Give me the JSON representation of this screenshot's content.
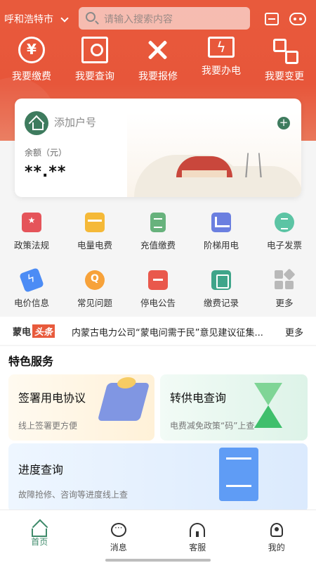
{
  "header": {
    "city": "呼和浩特市",
    "search_placeholder": "请输入搜索内容"
  },
  "quick_actions": [
    {
      "label": "我要缴费",
      "icon": "yuan-icon"
    },
    {
      "label": "我要查询",
      "icon": "search-document-icon"
    },
    {
      "label": "我要报修",
      "icon": "wrench-screwdriver-icon"
    },
    {
      "label": "我要办电",
      "icon": "electricity-board-icon"
    },
    {
      "label": "我要变更",
      "icon": "change-icon"
    }
  ],
  "account": {
    "add_label": "添加户号",
    "balance_label": "余额（元）",
    "balance_value": "**.**"
  },
  "services_row1": [
    {
      "label": "政策法规",
      "icon": "policy-icon"
    },
    {
      "label": "电量电费",
      "icon": "bill-icon"
    },
    {
      "label": "充值缴费",
      "icon": "recharge-icon"
    },
    {
      "label": "阶梯用电",
      "icon": "step-power-icon"
    },
    {
      "label": "电子发票",
      "icon": "invoice-icon"
    }
  ],
  "services_row2": [
    {
      "label": "电价信息",
      "icon": "price-tag-icon"
    },
    {
      "label": "常见问题",
      "icon": "faq-icon"
    },
    {
      "label": "停电公告",
      "icon": "outage-notice-icon"
    },
    {
      "label": "缴费记录",
      "icon": "payment-record-icon"
    },
    {
      "label": "更多",
      "icon": "more-grid-icon"
    }
  ],
  "news": {
    "logo_main": "蒙电",
    "logo_tag": "头条",
    "headline": "内蒙古电力公司“蒙电问需于民”意见建议征集...",
    "more": "更多"
  },
  "featured": {
    "title": "特色服务",
    "cards": [
      {
        "title": "签署用电协议",
        "subtitle": "线上签署更方便"
      },
      {
        "title": "转供电查询",
        "subtitle": "电费减免政策“码”上查"
      },
      {
        "title": "进度查询",
        "subtitle": "故障抢修、咨询等进度线上查"
      }
    ]
  },
  "bottom_nav": [
    {
      "label": "首页",
      "icon": "home-icon",
      "active": true
    },
    {
      "label": "消息",
      "icon": "message-icon"
    },
    {
      "label": "客服",
      "icon": "headset-icon"
    },
    {
      "label": "我的",
      "icon": "profile-icon"
    }
  ],
  "colors": {
    "brand_red": "#e85a3c",
    "brand_green": "#3e8a6a"
  }
}
